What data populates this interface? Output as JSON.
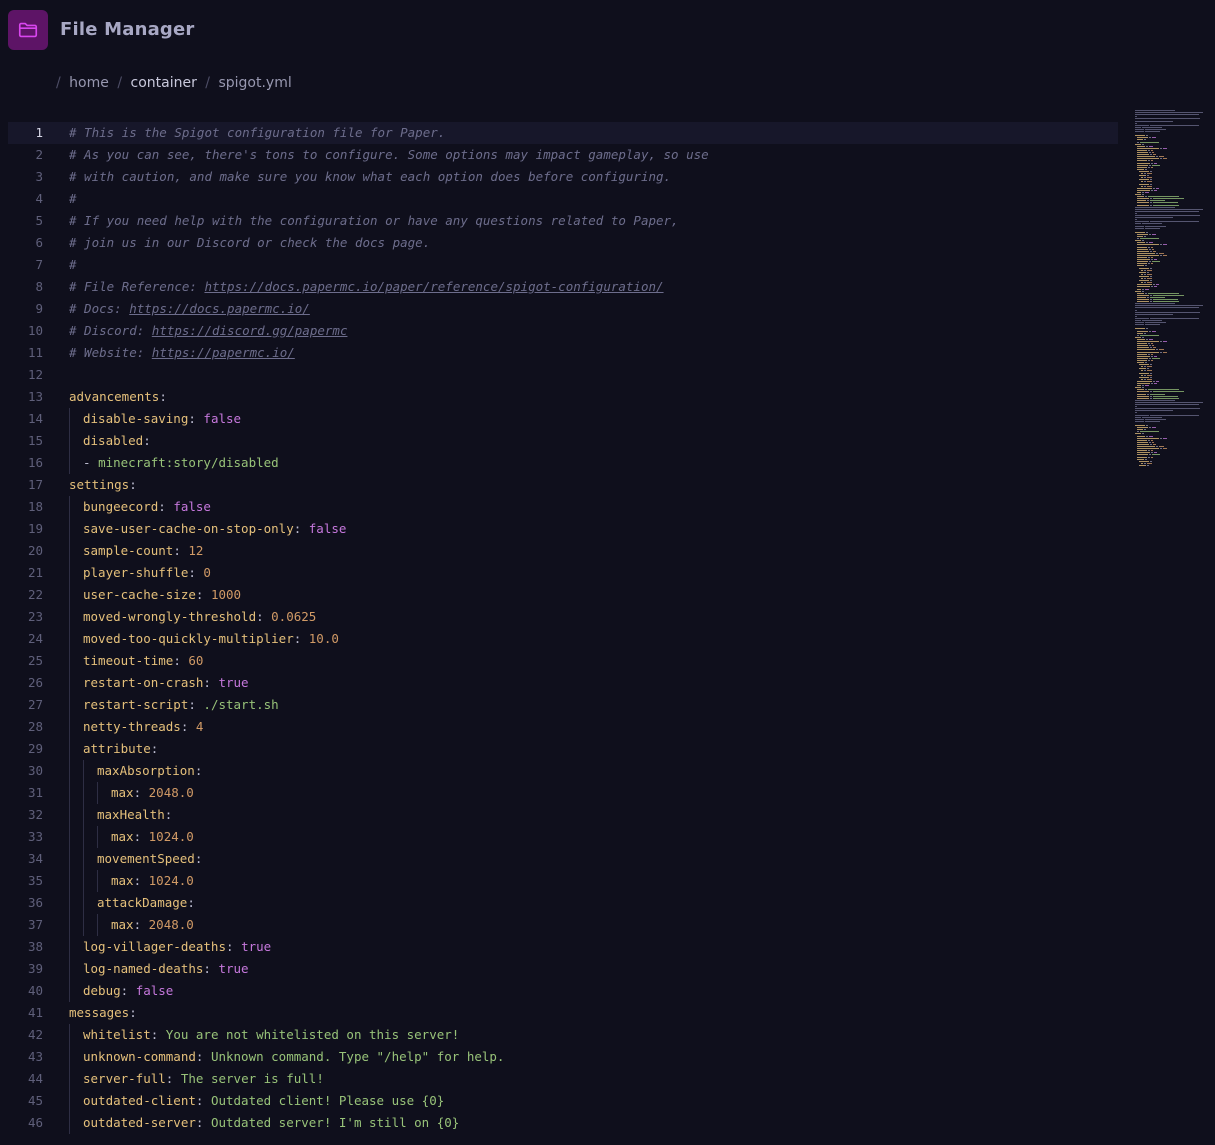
{
  "app": {
    "title": "File Manager",
    "icon": "folder-icon",
    "accent_color": "#c026d3"
  },
  "breadcrumb": {
    "separator": "/",
    "items": [
      {
        "label": "home",
        "current": false
      },
      {
        "label": "container",
        "current": false
      },
      {
        "label": "spigot.yml",
        "current": true
      }
    ]
  },
  "editor": {
    "active_line": 1,
    "lines": [
      {
        "n": "1",
        "indent": 0,
        "tokens": [
          [
            "c",
            "# This is the Spigot configuration file for Paper."
          ]
        ]
      },
      {
        "n": "2",
        "indent": 0,
        "tokens": [
          [
            "c",
            "# As you can see, there's tons to configure. Some options may impact gameplay, so use"
          ]
        ]
      },
      {
        "n": "3",
        "indent": 0,
        "tokens": [
          [
            "c",
            "# with caution, and make sure you know what each option does before configuring."
          ]
        ]
      },
      {
        "n": "4",
        "indent": 0,
        "tokens": [
          [
            "c",
            "#"
          ]
        ]
      },
      {
        "n": "5",
        "indent": 0,
        "tokens": [
          [
            "c",
            "# If you need help with the configuration or have any questions related to Paper,"
          ]
        ]
      },
      {
        "n": "6",
        "indent": 0,
        "tokens": [
          [
            "c",
            "# join us in our Discord or check the docs page."
          ]
        ]
      },
      {
        "n": "7",
        "indent": 0,
        "tokens": [
          [
            "c",
            "#"
          ]
        ]
      },
      {
        "n": "8",
        "indent": 0,
        "tokens": [
          [
            "c",
            "# File Reference: "
          ],
          [
            "u",
            "https://docs.papermc.io/paper/reference/spigot-configuration/"
          ]
        ]
      },
      {
        "n": "9",
        "indent": 0,
        "tokens": [
          [
            "c",
            "# Docs: "
          ],
          [
            "u",
            "https://docs.papermc.io/"
          ]
        ]
      },
      {
        "n": "10",
        "indent": 0,
        "tokens": [
          [
            "c",
            "# Discord: "
          ],
          [
            "u",
            "https://discord.gg/papermc"
          ]
        ]
      },
      {
        "n": "11",
        "indent": 0,
        "tokens": [
          [
            "c",
            "# Website: "
          ],
          [
            "u",
            "https://papermc.io/"
          ]
        ]
      },
      {
        "n": "12",
        "indent": 0,
        "tokens": []
      },
      {
        "n": "13",
        "indent": 0,
        "tokens": [
          [
            "k",
            "advancements"
          ],
          [
            "p",
            ":"
          ]
        ]
      },
      {
        "n": "14",
        "indent": 1,
        "tokens": [
          [
            "k",
            "disable-saving"
          ],
          [
            "p",
            ": "
          ],
          [
            "b",
            "false"
          ]
        ]
      },
      {
        "n": "15",
        "indent": 1,
        "tokens": [
          [
            "k",
            "disabled"
          ],
          [
            "p",
            ":"
          ]
        ]
      },
      {
        "n": "16",
        "indent": 1,
        "tokens": [
          [
            "p",
            "- "
          ],
          [
            "s",
            "minecraft:story/disabled"
          ]
        ]
      },
      {
        "n": "17",
        "indent": 0,
        "tokens": [
          [
            "k",
            "settings"
          ],
          [
            "p",
            ":"
          ]
        ]
      },
      {
        "n": "18",
        "indent": 1,
        "tokens": [
          [
            "k",
            "bungeecord"
          ],
          [
            "p",
            ": "
          ],
          [
            "b",
            "false"
          ]
        ]
      },
      {
        "n": "19",
        "indent": 1,
        "tokens": [
          [
            "k",
            "save-user-cache-on-stop-only"
          ],
          [
            "p",
            ": "
          ],
          [
            "b",
            "false"
          ]
        ]
      },
      {
        "n": "20",
        "indent": 1,
        "tokens": [
          [
            "k",
            "sample-count"
          ],
          [
            "p",
            ": "
          ],
          [
            "n",
            "12"
          ]
        ]
      },
      {
        "n": "21",
        "indent": 1,
        "tokens": [
          [
            "k",
            "player-shuffle"
          ],
          [
            "p",
            ": "
          ],
          [
            "n",
            "0"
          ]
        ]
      },
      {
        "n": "22",
        "indent": 1,
        "tokens": [
          [
            "k",
            "user-cache-size"
          ],
          [
            "p",
            ": "
          ],
          [
            "n",
            "1000"
          ]
        ]
      },
      {
        "n": "23",
        "indent": 1,
        "tokens": [
          [
            "k",
            "moved-wrongly-threshold"
          ],
          [
            "p",
            ": "
          ],
          [
            "n",
            "0.0625"
          ]
        ]
      },
      {
        "n": "24",
        "indent": 1,
        "tokens": [
          [
            "k",
            "moved-too-quickly-multiplier"
          ],
          [
            "p",
            ": "
          ],
          [
            "n",
            "10.0"
          ]
        ]
      },
      {
        "n": "25",
        "indent": 1,
        "tokens": [
          [
            "k",
            "timeout-time"
          ],
          [
            "p",
            ": "
          ],
          [
            "n",
            "60"
          ]
        ]
      },
      {
        "n": "26",
        "indent": 1,
        "tokens": [
          [
            "k",
            "restart-on-crash"
          ],
          [
            "p",
            ": "
          ],
          [
            "b",
            "true"
          ]
        ]
      },
      {
        "n": "27",
        "indent": 1,
        "tokens": [
          [
            "k",
            "restart-script"
          ],
          [
            "p",
            ": "
          ],
          [
            "s",
            "./start.sh"
          ]
        ]
      },
      {
        "n": "28",
        "indent": 1,
        "tokens": [
          [
            "k",
            "netty-threads"
          ],
          [
            "p",
            ": "
          ],
          [
            "n",
            "4"
          ]
        ]
      },
      {
        "n": "29",
        "indent": 1,
        "tokens": [
          [
            "k",
            "attribute"
          ],
          [
            "p",
            ":"
          ]
        ]
      },
      {
        "n": "30",
        "indent": 2,
        "tokens": [
          [
            "k",
            "maxAbsorption"
          ],
          [
            "p",
            ":"
          ]
        ]
      },
      {
        "n": "31",
        "indent": 3,
        "tokens": [
          [
            "k",
            "max"
          ],
          [
            "p",
            ": "
          ],
          [
            "n",
            "2048.0"
          ]
        ]
      },
      {
        "n": "32",
        "indent": 2,
        "tokens": [
          [
            "k",
            "maxHealth"
          ],
          [
            "p",
            ":"
          ]
        ]
      },
      {
        "n": "33",
        "indent": 3,
        "tokens": [
          [
            "k",
            "max"
          ],
          [
            "p",
            ": "
          ],
          [
            "n",
            "1024.0"
          ]
        ]
      },
      {
        "n": "34",
        "indent": 2,
        "tokens": [
          [
            "k",
            "movementSpeed"
          ],
          [
            "p",
            ":"
          ]
        ]
      },
      {
        "n": "35",
        "indent": 3,
        "tokens": [
          [
            "k",
            "max"
          ],
          [
            "p",
            ": "
          ],
          [
            "n",
            "1024.0"
          ]
        ]
      },
      {
        "n": "36",
        "indent": 2,
        "tokens": [
          [
            "k",
            "attackDamage"
          ],
          [
            "p",
            ":"
          ]
        ]
      },
      {
        "n": "37",
        "indent": 3,
        "tokens": [
          [
            "k",
            "max"
          ],
          [
            "p",
            ": "
          ],
          [
            "n",
            "2048.0"
          ]
        ]
      },
      {
        "n": "38",
        "indent": 1,
        "tokens": [
          [
            "k",
            "log-villager-deaths"
          ],
          [
            "p",
            ": "
          ],
          [
            "b",
            "true"
          ]
        ]
      },
      {
        "n": "39",
        "indent": 1,
        "tokens": [
          [
            "k",
            "log-named-deaths"
          ],
          [
            "p",
            ": "
          ],
          [
            "b",
            "true"
          ]
        ]
      },
      {
        "n": "40",
        "indent": 1,
        "tokens": [
          [
            "k",
            "debug"
          ],
          [
            "p",
            ": "
          ],
          [
            "b",
            "false"
          ]
        ]
      },
      {
        "n": "41",
        "indent": 0,
        "tokens": [
          [
            "k",
            "messages"
          ],
          [
            "p",
            ":"
          ]
        ]
      },
      {
        "n": "42",
        "indent": 1,
        "tokens": [
          [
            "k",
            "whitelist"
          ],
          [
            "p",
            ": "
          ],
          [
            "s",
            "You are not whitelisted on this server!"
          ]
        ]
      },
      {
        "n": "43",
        "indent": 1,
        "tokens": [
          [
            "k",
            "unknown-command"
          ],
          [
            "p",
            ": "
          ],
          [
            "s",
            "Unknown command. Type \"/help\" for help."
          ]
        ]
      },
      {
        "n": "44",
        "indent": 1,
        "tokens": [
          [
            "k",
            "server-full"
          ],
          [
            "p",
            ": "
          ],
          [
            "s",
            "The server is full!"
          ]
        ]
      },
      {
        "n": "45",
        "indent": 1,
        "tokens": [
          [
            "k",
            "outdated-client"
          ],
          [
            "p",
            ": "
          ],
          [
            "s",
            "Outdated client! Please use {0}"
          ]
        ]
      },
      {
        "n": "46",
        "indent": 1,
        "tokens": [
          [
            "k",
            "outdated-server"
          ],
          [
            "p",
            ": "
          ],
          [
            "s",
            "Outdated server! I'm still on {0}"
          ]
        ]
      }
    ]
  },
  "colors": {
    "comment": "#6d6d8c",
    "key": "#e5c07b",
    "boolean": "#c678dd",
    "number": "#d19a66",
    "string": "#98c379"
  }
}
